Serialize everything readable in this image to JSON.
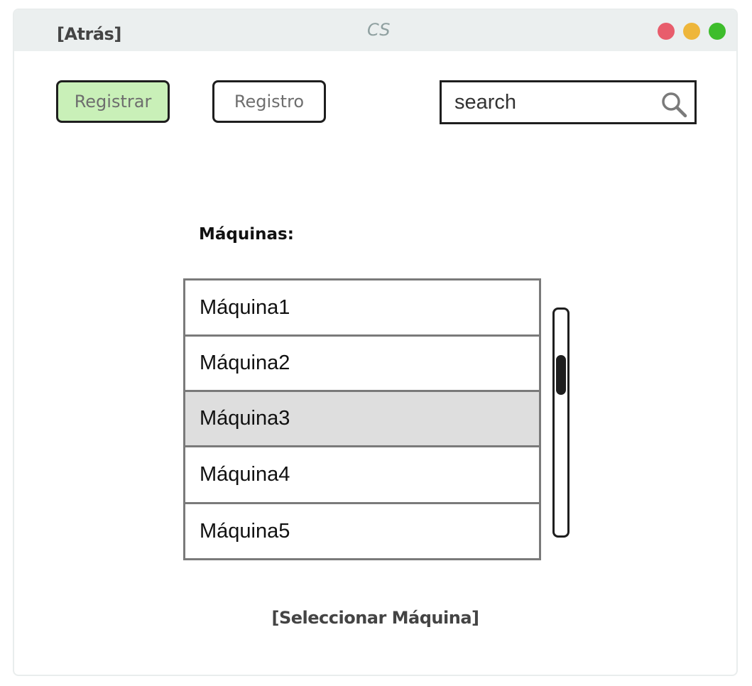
{
  "window": {
    "title": "CS",
    "back_label": "[Atrás]",
    "controls": {
      "close_color": "#e85d6c",
      "minimize_color": "#eeb63b",
      "maximize_color": "#3dbd2b"
    }
  },
  "toolbar": {
    "registrar_label": "Registrar",
    "registrar_bg": "#c9f0b8",
    "registro_label": "Registro",
    "search": {
      "placeholder": "search",
      "icon": "search-icon"
    }
  },
  "machines": {
    "label": "Máquinas:",
    "items": [
      {
        "label": "Máquina1",
        "selected": false
      },
      {
        "label": "Máquina2",
        "selected": false
      },
      {
        "label": "Máquina3",
        "selected": true
      },
      {
        "label": "Máquina4",
        "selected": false
      },
      {
        "label": "Máquina5",
        "selected": false
      }
    ]
  },
  "footer": {
    "select_label": "[Seleccionar Máquina]"
  }
}
